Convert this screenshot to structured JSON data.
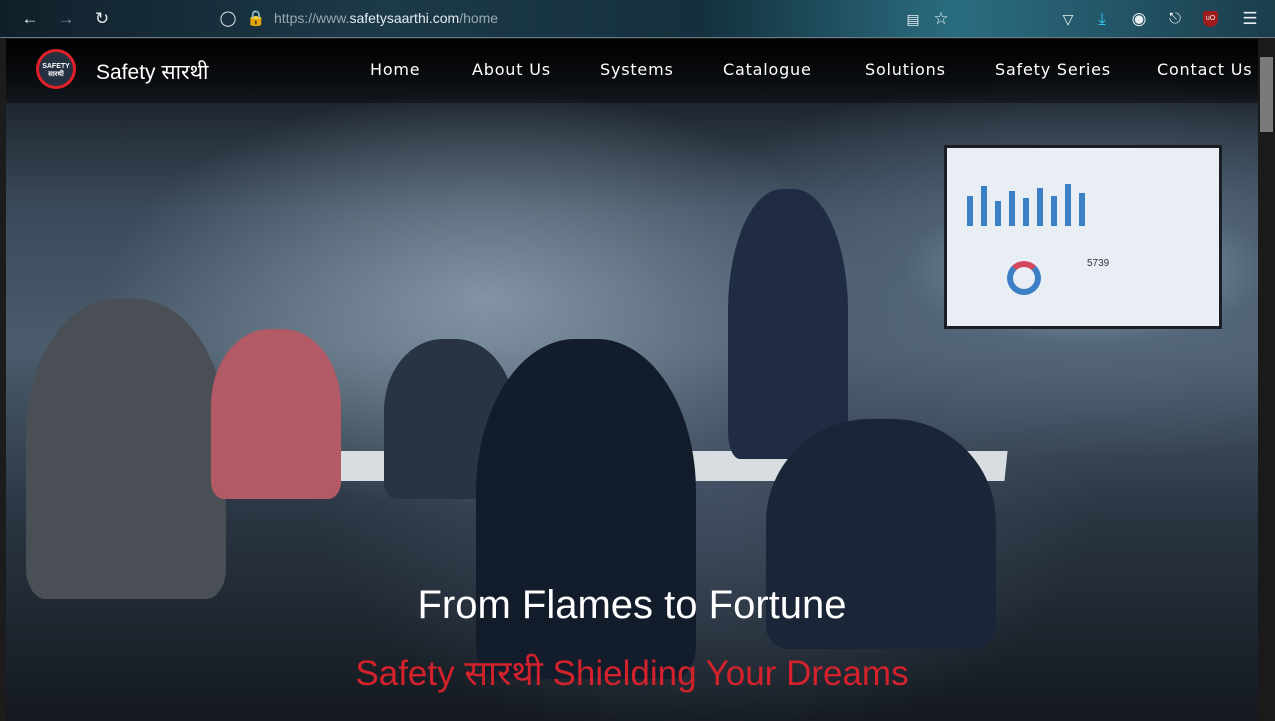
{
  "browser": {
    "url_prefix": "https://www.",
    "url_domain": "safetysaarthi.com",
    "url_path": "/home",
    "icons": [
      "back-icon",
      "forward-icon",
      "reload-icon",
      "shield-icon",
      "lock-icon",
      "reader-view-icon",
      "bookmark-star-icon",
      "pocket-icon",
      "download-icon",
      "account-icon",
      "extensions-icon",
      "ublock-icon",
      "menu-icon"
    ]
  },
  "nav": {
    "logo_text_top": "SAFETY",
    "logo_text_bottom": "सारथी",
    "brand": "Safety सारथी",
    "items": [
      "Home",
      "About Us",
      "Systems",
      "Catalogue",
      "Solutions",
      "Safety Series",
      "Contact Us"
    ]
  },
  "hero": {
    "title": "From Flames to Fortune",
    "subtitle": "Safety सारथी Shielding Your Dreams",
    "screen_number": "5739"
  },
  "colors": {
    "accent": "#d3222c"
  }
}
